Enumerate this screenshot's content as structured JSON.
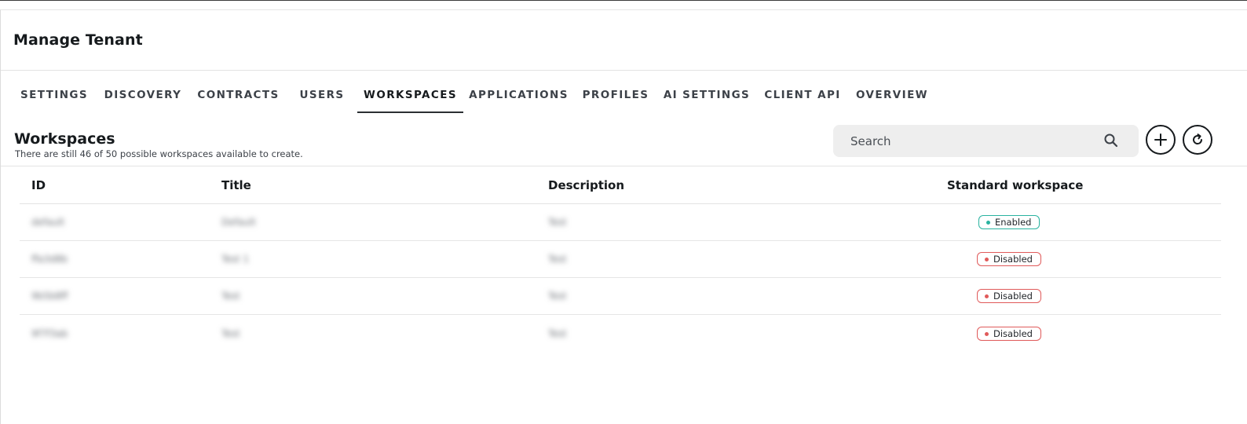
{
  "page": {
    "title": "Manage Tenant"
  },
  "tabs": [
    {
      "label": "SETTINGS",
      "active": false
    },
    {
      "label": "DISCOVERY",
      "active": false
    },
    {
      "label": "CONTRACTS",
      "active": false
    },
    {
      "label": "USERS",
      "active": false
    },
    {
      "label": "WORKSPACES",
      "active": true
    },
    {
      "label": "APPLICATIONS",
      "active": false
    },
    {
      "label": "PROFILES",
      "active": false
    },
    {
      "label": "AI SETTINGS",
      "active": false
    },
    {
      "label": "CLIENT API",
      "active": false
    },
    {
      "label": "OVERVIEW",
      "active": false
    }
  ],
  "section": {
    "title": "Workspaces",
    "subtitle": "There are still 46 of 50 possible workspaces available to create."
  },
  "search": {
    "placeholder": "Search",
    "icon": "search-icon"
  },
  "actions": {
    "add_icon": "plus-icon",
    "refresh_icon": "refresh-icon"
  },
  "table": {
    "columns": [
      "ID",
      "Title",
      "Description",
      "Standard workspace"
    ],
    "rows": [
      {
        "id": "default",
        "title": "Default",
        "description": "Test",
        "standard": "Enabled",
        "status": "enabled"
      },
      {
        "id": "ffa3d8b",
        "title": "Test 1",
        "description": "Test",
        "standard": "Disabled",
        "status": "disabled"
      },
      {
        "id": "9b5b8ff",
        "title": "Test",
        "description": "Test",
        "standard": "Disabled",
        "status": "disabled"
      },
      {
        "id": "9f7f3ab",
        "title": "Test",
        "description": "Test",
        "standard": "Disabled",
        "status": "disabled"
      }
    ]
  },
  "colors": {
    "enabled": "#2ab3a0",
    "disabled": "#e05a5a",
    "text": "#161a1d"
  }
}
